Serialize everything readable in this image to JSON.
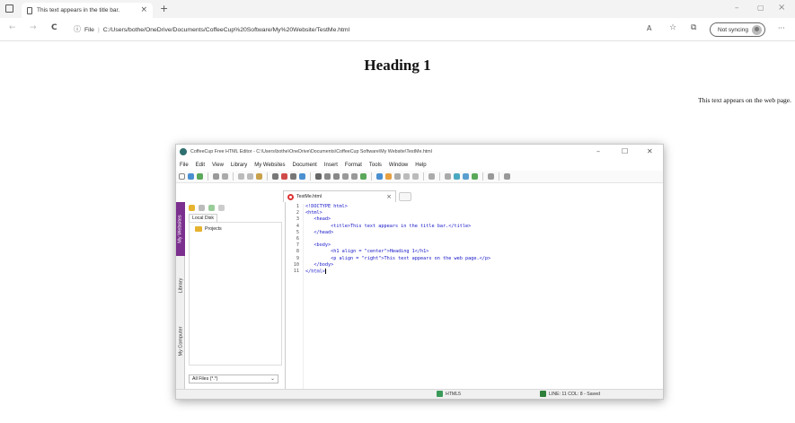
{
  "browser": {
    "tab": {
      "title": "This text appears in the title bar.",
      "close_glyph": "×",
      "icon": "page-icon"
    },
    "new_tab_glyph": "+",
    "window_controls": {
      "minimize": "–",
      "maximize": "▢",
      "close": "×"
    },
    "nav": {
      "back": "←",
      "forward": "→",
      "refresh": "C"
    },
    "address": {
      "label": "File",
      "url": "C:/Users/bothe/OneDrive/Documents/CoffeeCup%20Software/My%20Website/TestMe.html"
    },
    "sync": {
      "label": "Not syncing"
    },
    "more_glyph": "···"
  },
  "page": {
    "heading": "Heading 1",
    "paragraph": "This text appears on the web page."
  },
  "editor": {
    "title": "CoffeeCup Free HTML Editor - C:\\Users\\bothe\\OneDrive\\Documents\\CoffeeCup Software\\My Website\\TestMe.html",
    "window_controls": {
      "minimize": "–",
      "maximize": "☐",
      "close": "✕"
    },
    "menu": [
      "File",
      "Edit",
      "View",
      "Library",
      "My Websites",
      "Document",
      "Insert",
      "Format",
      "Tools",
      "Window",
      "Help"
    ],
    "side_tabs": [
      "My Websites",
      "Library",
      "My Computer"
    ],
    "left_panel": {
      "disk_tab": "Local Disk",
      "tree_item": "Projects",
      "filter": "All Files (*.*)"
    },
    "doc_tab": {
      "label": "TestMe.html",
      "close_glyph": "×"
    },
    "line_numbers": [
      "1",
      "2",
      "3",
      "4",
      "5",
      "6",
      "7",
      "8",
      "9",
      "10",
      "11"
    ],
    "code": [
      "<!DOCTYPE html>",
      "<html>",
      "   <head>",
      "         <title>This text appears in the title bar.</title>",
      "   </head>",
      "",
      "   <body>",
      "         <h1 align = \"center\">Heading 1</h1>",
      "         <p align = \"right\">This text appears on the web page.</p>",
      "   </body>",
      "</html>"
    ],
    "status": {
      "doc_type": "HTML5",
      "position": "LINE: 11  COL: 8 - Saved"
    }
  },
  "colors": {
    "accent_purple": "#7b2f8e",
    "code_blue": "#1515c8",
    "tab_red": "#d33333"
  }
}
